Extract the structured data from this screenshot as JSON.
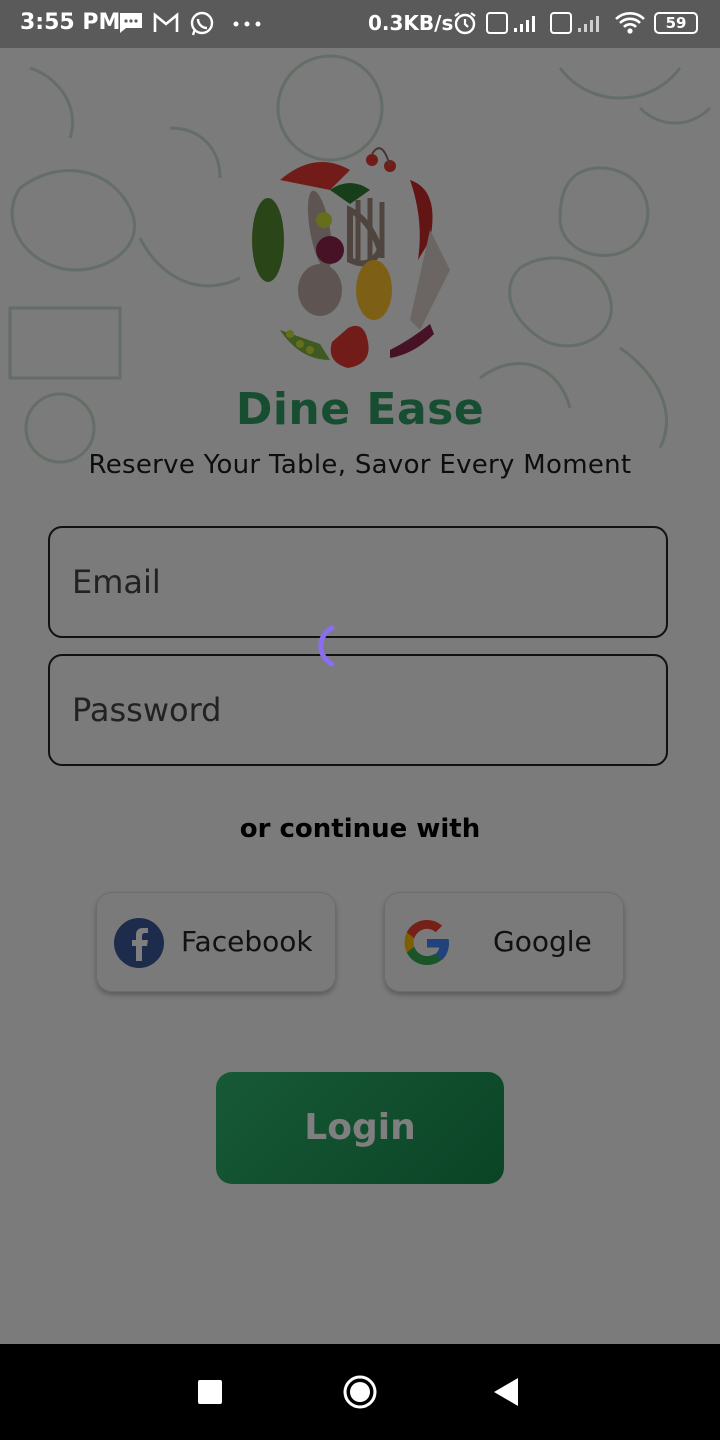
{
  "status_bar": {
    "time": "3:55 PM",
    "network_speed": "0.3KB/s",
    "battery": "59",
    "icons": [
      "message-icon",
      "gmail-icon",
      "whatsapp-icon",
      "more-icon",
      "alarm-icon",
      "volte-icon",
      "signal-icon",
      "wifi-icon",
      "battery-icon"
    ]
  },
  "app": {
    "title": "Dine Ease",
    "tagline": "Reserve Your Table, Savor Every Moment",
    "title_color": "#2e9b60"
  },
  "form": {
    "email_placeholder": "Email",
    "password_placeholder": "Password"
  },
  "social": {
    "divider_text": "or continue with",
    "facebook_label": "Facebook",
    "google_label": "Google"
  },
  "login": {
    "label": "Login",
    "color": "#1f9f5c"
  },
  "state": {
    "loading": true,
    "spinner_color": "#8a6df0"
  },
  "nav_bar": {
    "icons": [
      "recent-apps-icon",
      "home-icon",
      "back-icon"
    ]
  }
}
